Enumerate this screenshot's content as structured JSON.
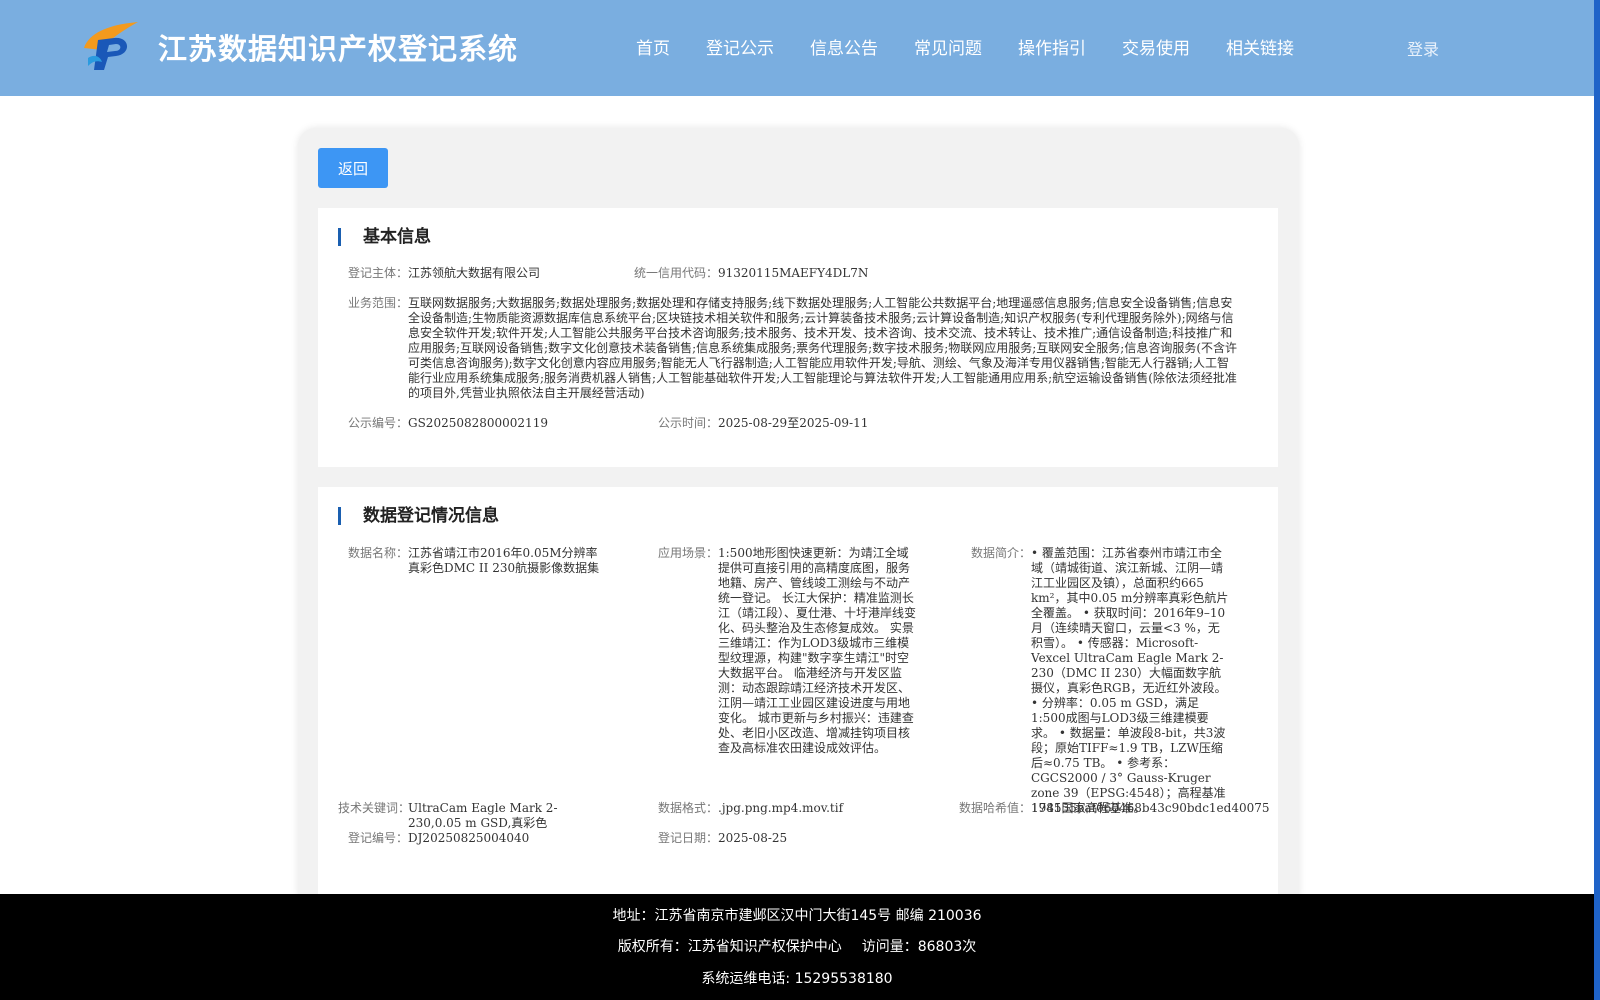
{
  "header": {
    "title": "江苏数据知识产权登记系统",
    "nav": [
      "首页",
      "登记公示",
      "信息公告",
      "常见问题",
      "操作指引",
      "交易使用",
      "相关链接"
    ],
    "login": "登录"
  },
  "back_button": "返回",
  "basic": {
    "title": "基本信息",
    "entity_label": "登记主体：",
    "entity": "江苏领航大数据有限公司",
    "credit_label": "统一信用代码：",
    "credit": "91320115MAEFY4DL7N",
    "scope_label": "业务范围：",
    "scope": "互联网数据服务;大数据服务;数据处理服务;数据处理和存储支持服务;线下数据处理服务;人工智能公共数据平台;地理遥感信息服务;信息安全设备销售;信息安全设备制造;生物质能资源数据库信息系统平台;区块链技术相关软件和服务;云计算装备技术服务;云计算设备制造;知识产权服务(专利代理服务除外);网络与信息安全软件开发;软件开发;人工智能公共服务平台技术咨询服务;技术服务、技术开发、技术咨询、技术交流、技术转让、技术推广;通信设备制造;科技推广和应用服务;互联网设备销售;数字文化创意技术装备销售;信息系统集成服务;票务代理服务;数字技术服务;物联网应用服务;互联网安全服务;信息咨询服务(不含许可类信息咨询服务);数字文化创意内容应用服务;智能无人飞行器制造;人工智能应用软件开发;导航、测绘、气象及海洋专用仪器销售;智能无人行器销;人工智能行业应用系统集成服务;服务消费机器人销售;人工智能基础软件开发;人工智能理论与算法软件开发;人工智能通用应用系;航空运输设备销售(除依法须经批准的项目外,凭营业执照依法自主开展经营活动)",
    "notice_no_label": "公示编号：",
    "notice_no": "GS2025082800002119",
    "notice_time_label": "公示时间：",
    "notice_time": "2025-08-29至2025-09-11"
  },
  "data_info": {
    "title": "数据登记情况信息",
    "name_label": "数据名称：",
    "name": "江苏省靖江市2016年0.05M分辨率真彩色DMC II 230航摄影像数据集",
    "scene_label": "应用场景：",
    "scene": "1:500地形图快速更新：为靖江全域提供可直接引用的高精度底图，服务地籍、房产、管线竣工测绘与不动产统一登记。 长江大保护：精准监测长江（靖江段）、夏仕港、十圩港岸线变化、码头整治及生态修复成效。 实景三维靖江：作为LOD3级城市三维模型纹理源，构建\"数字孪生靖江\"时空大数据平台。 临港经济与开发区监测：动态跟踪靖江经济技术开发区、江阴—靖江工业园区建设进度与用地变化。 城市更新与乡村振兴：违建查处、老旧小区改造、增减挂钩项目核查及高标准农田建设成效评估。",
    "intro_label": "数据简介：",
    "intro": "• 覆盖范围：江苏省泰州市靖江市全域（靖城街道、滨江新城、江阴—靖江工业园区及镇），总面积约665 km²，其中0.05 m分辨率真彩色航片全覆盖。 • 获取时间：2016年9–10月（连续晴天窗口，云量<3 %，无积雪）。 • 传感器：Microsoft-Vexcel UltraCam Eagle Mark 2-230（DMC II 230）大幅面数字航摄仪，真彩色RGB，无近红外波段。 • 分辨率：0.05 m GSD，满足1:500成图与LOD3级三维建模要求。 • 数据量：单波段8-bit，共3波段；原始TIFF≈1.9 TB，LZW压缩后≈0.75 TB。 • 参考系：CGCS2000 / 3° Gauss-Kruger zone 39（EPSG:4548）；高程基准1985国家高程基准。",
    "keywords_label": "技术关键词：",
    "keywords": "UltraCam Eagle Mark 2-230,0.05 m GSD,真彩色",
    "format_label": "数据格式：",
    "format": ".jpg.png.mp4.mov.tif",
    "hash_label": "数据哈希值：",
    "hash": "174155baf060468b43c90bdc1ed40075",
    "reg_no_label": "登记编号：",
    "reg_no": "DJ20250825004040",
    "reg_date_label": "登记日期：",
    "reg_date": "2025-08-25"
  },
  "footer": {
    "address": "地址：江苏省南京市建邺区汉中门大街145号 邮编 210036",
    "copyright": "版权所有：江苏省知识产权保护中心",
    "visits": "访问量：86803次",
    "phone": "系统运维电话: 15295538180"
  }
}
